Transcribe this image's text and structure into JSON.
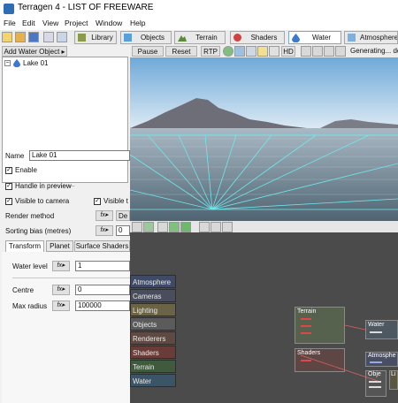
{
  "window": {
    "app_name": "Terragen 4",
    "separator": "-",
    "document_title": "LIST OF FREEWARE"
  },
  "menu": [
    "File",
    "Edit",
    "View",
    "Project",
    "Window",
    "Help"
  ],
  "toolbar": {
    "tabs": [
      {
        "label": "Library",
        "icon": "library-icon"
      },
      {
        "label": "Objects",
        "icon": "cube-icon"
      },
      {
        "label": "Terrain",
        "icon": "mountain-icon"
      },
      {
        "label": "Shaders",
        "icon": "sphere-icon"
      },
      {
        "label": "Water",
        "icon": "droplet-icon",
        "active": true
      },
      {
        "label": "Atmosphere",
        "icon": "cloud-icon"
      }
    ]
  },
  "left_panel": {
    "add_button": "Add Water Object",
    "tree_item": "Lake 01",
    "name_label": "Name",
    "name_value": "Lake 01",
    "checkboxes": [
      {
        "label": "Enable",
        "checked": true
      },
      {
        "label": "Handle in preview",
        "checked": true
      },
      {
        "label": "Visible to camera",
        "checked": true
      },
      {
        "label": "Visible t",
        "checked": true
      }
    ],
    "render_method_label": "Render method",
    "render_method_value": "De",
    "sorting_bias_label": "Sorting bias (metres)",
    "sorting_bias_value": "0",
    "sub_tabs": [
      "Transform",
      "Planet",
      "Surface Shaders"
    ],
    "water_level_label": "Water level",
    "water_level_value": "1",
    "centre_label": "Centre",
    "centre_value": "0",
    "max_radius_label": "Max radius",
    "max_radius_value": "100000",
    "fx_label": "fx"
  },
  "view_toolbar": {
    "pause": "Pause",
    "reset": "Reset",
    "rtp": "RTP",
    "hd": "HD",
    "status": "Generating... detai"
  },
  "node_graph": {
    "groups": [
      {
        "label": "Atmosphere",
        "color": "#3f4a66"
      },
      {
        "label": "Cameras",
        "color": "#4a4e5c"
      },
      {
        "label": "Lighting",
        "color": "#6a6345"
      },
      {
        "label": "Objects",
        "color": "#5b5b5b"
      },
      {
        "label": "Renderers",
        "color": "#5e4a42"
      },
      {
        "label": "Shaders",
        "color": "#6a3c38"
      },
      {
        "label": "Terrain",
        "color": "#3f5a3c"
      },
      {
        "label": "Water",
        "color": "#3c5566"
      }
    ],
    "nodes": {
      "terrain": "Terrain",
      "shaders": "Shaders",
      "water": "Water",
      "atmosphere": "Atmosphe",
      "objects": "Obje",
      "lighting": "Li"
    }
  }
}
